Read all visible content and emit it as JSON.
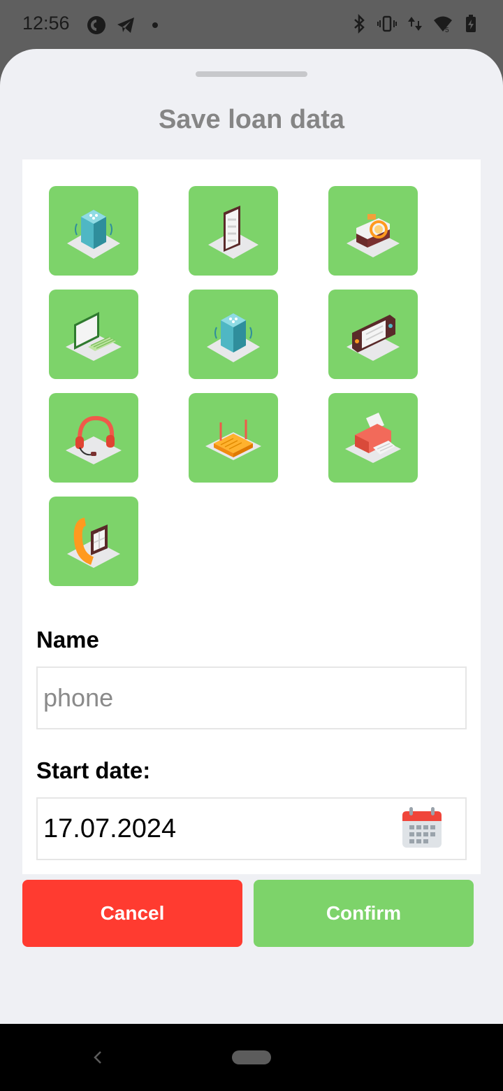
{
  "status_bar": {
    "time": "12:56",
    "icons": [
      "pocket-casts-icon",
      "telegram-icon",
      "dot-icon",
      "bluetooth-icon",
      "vibrate-icon",
      "data-arrows-icon",
      "wifi-icon",
      "battery-icon"
    ],
    "wifi_badge": "5"
  },
  "sheet": {
    "title": "Save loan data"
  },
  "device_icons": [
    {
      "name": "smart-speaker-icon"
    },
    {
      "name": "tablet-icon"
    },
    {
      "name": "camera-icon"
    },
    {
      "name": "computer-icon"
    },
    {
      "name": "smart-speaker-icon"
    },
    {
      "name": "game-console-icon"
    },
    {
      "name": "headphones-icon"
    },
    {
      "name": "router-icon"
    },
    {
      "name": "printer-icon"
    },
    {
      "name": "smartwatch-icon"
    }
  ],
  "form": {
    "name_label": "Name",
    "name_placeholder": "phone",
    "name_value": "",
    "date_label": "Start date:",
    "date_value": "17.07.2024"
  },
  "buttons": {
    "cancel_label": "Cancel",
    "confirm_label": "Confirm"
  },
  "colors": {
    "tile_green": "#7dd36a",
    "cancel_red": "#ff3b30",
    "confirm_green": "#7dd36a",
    "title_gray": "#858585",
    "sheet_bg": "#eff0f4"
  }
}
